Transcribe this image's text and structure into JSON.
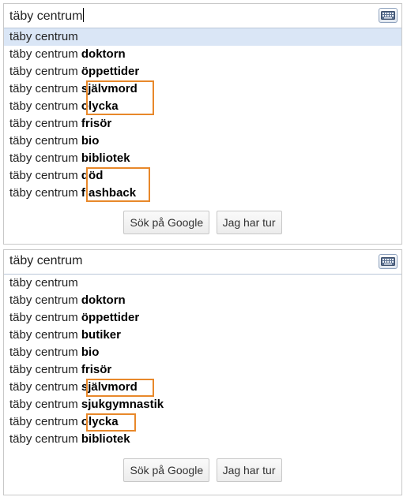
{
  "panels": [
    {
      "query": "täby centrum",
      "caret_visible": true,
      "suggestions": [
        {
          "prefix": "täby centrum",
          "completion": "",
          "selected": true
        },
        {
          "prefix": "täby centrum",
          "completion": "doktorn"
        },
        {
          "prefix": "täby centrum",
          "completion": "öppettider"
        },
        {
          "prefix": "täby centrum",
          "completion": "självmord"
        },
        {
          "prefix": "täby centrum",
          "completion": "olycka"
        },
        {
          "prefix": "täby centrum",
          "completion": "frisör"
        },
        {
          "prefix": "täby centrum",
          "completion": "bio"
        },
        {
          "prefix": "täby centrum",
          "completion": "bibliotek"
        },
        {
          "prefix": "täby centrum",
          "completion": "död"
        },
        {
          "prefix": "täby centrum",
          "completion": "flashback"
        }
      ],
      "search_button": "Sök på Google",
      "lucky_button": "Jag har tur"
    },
    {
      "query": "täby centrum",
      "caret_visible": false,
      "suggestions": [
        {
          "prefix": "täby centrum",
          "completion": ""
        },
        {
          "prefix": "täby centrum",
          "completion": "doktorn"
        },
        {
          "prefix": "täby centrum",
          "completion": "öppettider"
        },
        {
          "prefix": "täby centrum",
          "completion": "butiker"
        },
        {
          "prefix": "täby centrum",
          "completion": "bio"
        },
        {
          "prefix": "täby centrum",
          "completion": "frisör"
        },
        {
          "prefix": "täby centrum",
          "completion": "självmord"
        },
        {
          "prefix": "täby centrum",
          "completion": "sjukgymnastik"
        },
        {
          "prefix": "täby centrum",
          "completion": "olycka"
        },
        {
          "prefix": "täby centrum",
          "completion": "bibliotek"
        }
      ],
      "search_button": "Sök på Google",
      "lucky_button": "Jag har tur"
    }
  ],
  "highlight_color": "#e8882a",
  "selected_row_color": "#dae6f6",
  "icons": {
    "keyboard": "keyboard-icon"
  }
}
